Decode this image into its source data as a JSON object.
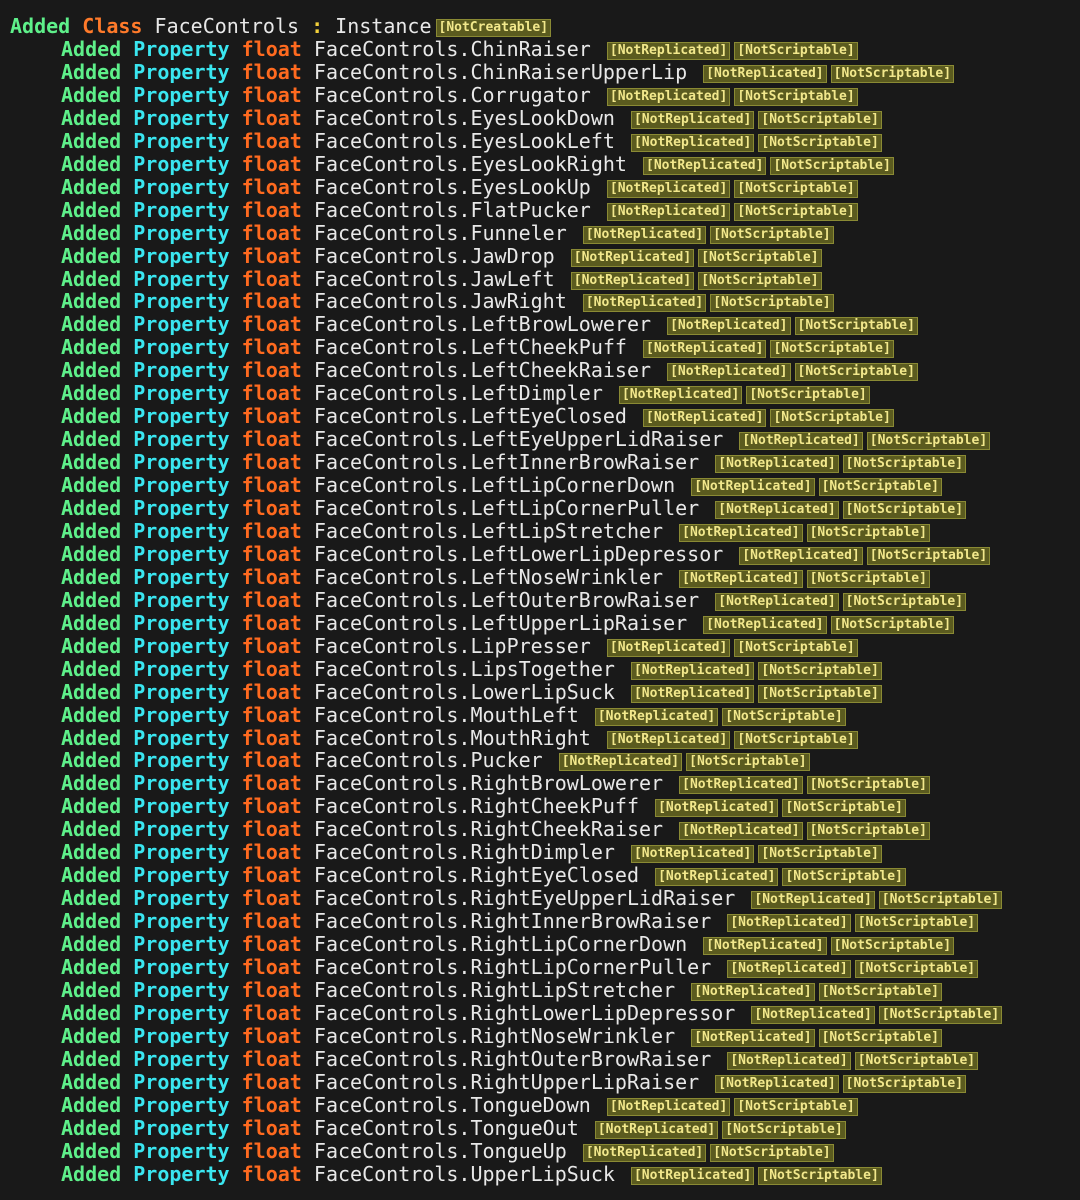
{
  "header": {
    "added": "Added",
    "kind": "Class",
    "class_name": "FaceControls",
    "colon": ":",
    "superclass": "Instance",
    "tags": [
      "[NotCreatable]"
    ]
  },
  "labels": {
    "added": "Added",
    "kind": "Property",
    "type": "float"
  },
  "tags": [
    "[NotReplicated]",
    "[NotScriptable]"
  ],
  "properties": [
    "FaceControls.ChinRaiser",
    "FaceControls.ChinRaiserUpperLip",
    "FaceControls.Corrugator",
    "FaceControls.EyesLookDown",
    "FaceControls.EyesLookLeft",
    "FaceControls.EyesLookRight",
    "FaceControls.EyesLookUp",
    "FaceControls.FlatPucker",
    "FaceControls.Funneler",
    "FaceControls.JawDrop",
    "FaceControls.JawLeft",
    "FaceControls.JawRight",
    "FaceControls.LeftBrowLowerer",
    "FaceControls.LeftCheekPuff",
    "FaceControls.LeftCheekRaiser",
    "FaceControls.LeftDimpler",
    "FaceControls.LeftEyeClosed",
    "FaceControls.LeftEyeUpperLidRaiser",
    "FaceControls.LeftInnerBrowRaiser",
    "FaceControls.LeftLipCornerDown",
    "FaceControls.LeftLipCornerPuller",
    "FaceControls.LeftLipStretcher",
    "FaceControls.LeftLowerLipDepressor",
    "FaceControls.LeftNoseWrinkler",
    "FaceControls.LeftOuterBrowRaiser",
    "FaceControls.LeftUpperLipRaiser",
    "FaceControls.LipPresser",
    "FaceControls.LipsTogether",
    "FaceControls.LowerLipSuck",
    "FaceControls.MouthLeft",
    "FaceControls.MouthRight",
    "FaceControls.Pucker",
    "FaceControls.RightBrowLowerer",
    "FaceControls.RightCheekPuff",
    "FaceControls.RightCheekRaiser",
    "FaceControls.RightDimpler",
    "FaceControls.RightEyeClosed",
    "FaceControls.RightEyeUpperLidRaiser",
    "FaceControls.RightInnerBrowRaiser",
    "FaceControls.RightLipCornerDown",
    "FaceControls.RightLipCornerPuller",
    "FaceControls.RightLipStretcher",
    "FaceControls.RightLowerLipDepressor",
    "FaceControls.RightNoseWrinkler",
    "FaceControls.RightOuterBrowRaiser",
    "FaceControls.RightUpperLipRaiser",
    "FaceControls.TongueDown",
    "FaceControls.TongueOut",
    "FaceControls.TongueUp",
    "FaceControls.UpperLipSuck"
  ],
  "colors": {
    "background": "#191919",
    "added": "#5ef08a",
    "class_keyword": "#ff7a2a",
    "property_keyword": "#3ae6f0",
    "type_keyword": "#ff6a1f",
    "tag_text": "#f2e88c",
    "tag_background": "#5b5b1f"
  }
}
